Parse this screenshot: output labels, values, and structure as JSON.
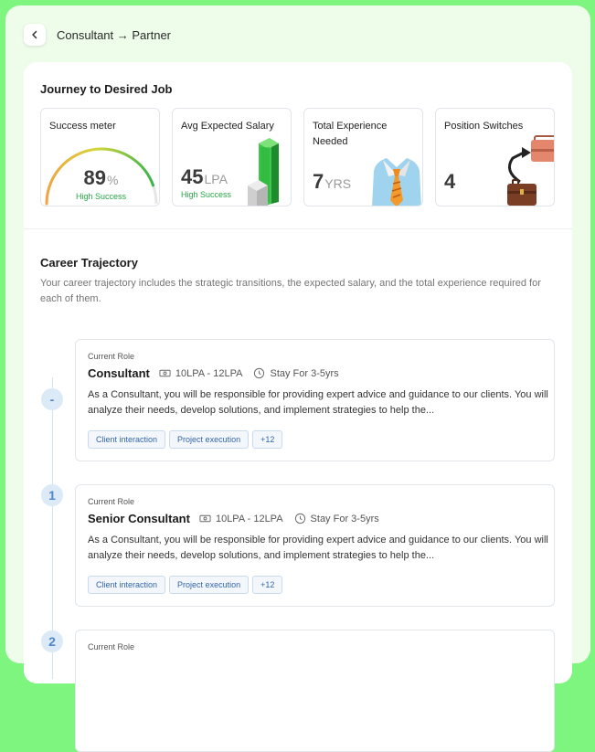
{
  "header": {
    "title": "Consultant → Partner"
  },
  "journey": {
    "title": "Journey to Desired Job",
    "metrics": {
      "success": {
        "label": "Success meter",
        "value": "89",
        "unit": "%",
        "status": "High Success",
        "fraction": 0.89
      },
      "salary": {
        "label": "Avg Expected Salary",
        "value": "45",
        "unit": "LPA",
        "status": "High Success"
      },
      "experience": {
        "label": "Total Experience Needed",
        "value": "7",
        "unit": "YRS"
      },
      "switches": {
        "label": "Position Switches",
        "value": "4"
      }
    }
  },
  "trajectory": {
    "title": "Career Trajectory",
    "description": "Your career trajectory includes the strategic transitions, the expected salary, and the total experience required for each of them.",
    "roles": [
      {
        "step": "-",
        "eyebrow": "Current Role",
        "name": "Consultant",
        "salary": "10LPA - 12LPA",
        "stay": "Stay For 3-5yrs",
        "description": "As a Consultant, you will be responsible for providing expert advice and guidance to our clients. You will analyze their needs, develop solutions, and implement strategies to help the...",
        "tags": [
          "Client interaction",
          "Project execution",
          "+12"
        ]
      },
      {
        "step": "1",
        "eyebrow": "Current Role",
        "name": "Senior Consultant",
        "salary": "10LPA - 12LPA",
        "stay": "Stay For 3-5yrs",
        "description": "As a Consultant, you will be responsible for providing expert advice and guidance to our clients. You will analyze their needs, develop solutions, and implement strategies to help the...",
        "tags": [
          "Client interaction",
          "Project execution",
          "+12"
        ]
      },
      {
        "step": "2",
        "eyebrow": "Current Role"
      }
    ]
  },
  "colors": {
    "accent_green": "#27a845",
    "timeline_blue": "#4f86c8",
    "frame_green": "#7ef57e"
  }
}
